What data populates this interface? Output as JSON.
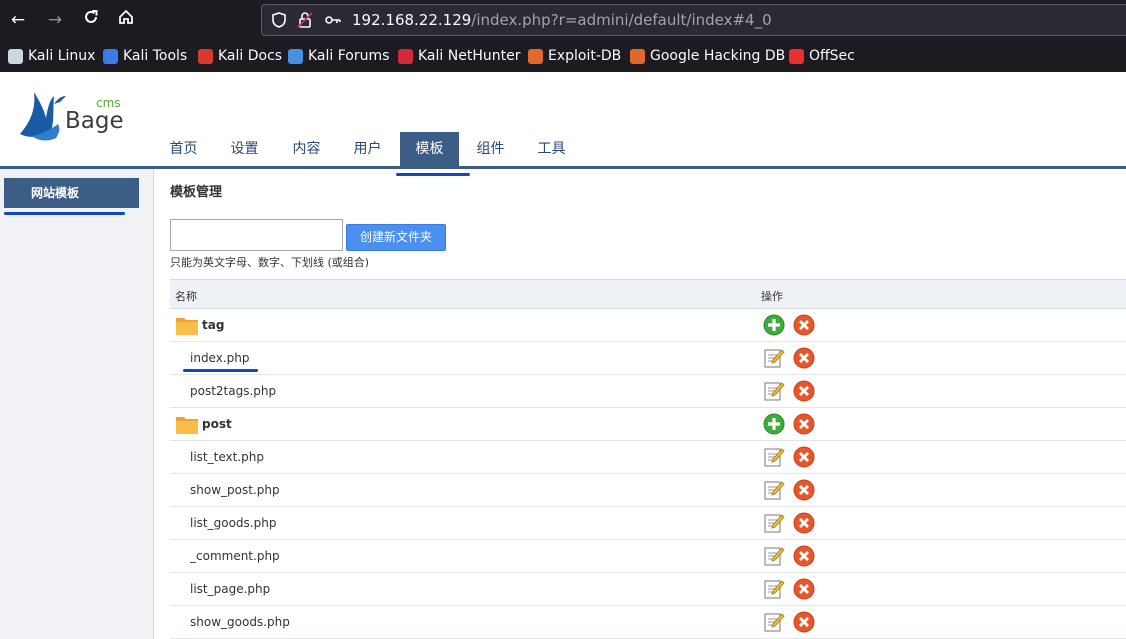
{
  "browser": {
    "url_host": "192.168.22.129",
    "url_path": "/index.php?r=admini/default/index#4_0"
  },
  "bookmarks": [
    {
      "label": "Kali Linux",
      "icon": "kali-dragon-icon"
    },
    {
      "label": "Kali Tools",
      "icon": "kali-tools-icon"
    },
    {
      "label": "Kali Docs",
      "icon": "kali-docs-icon"
    },
    {
      "label": "Kali Forums",
      "icon": "kali-forums-icon"
    },
    {
      "label": "Kali NetHunter",
      "icon": "kali-nethunter-icon"
    },
    {
      "label": "Exploit-DB",
      "icon": "exploit-db-icon"
    },
    {
      "label": "Google Hacking DB",
      "icon": "ghdb-icon"
    },
    {
      "label": "OffSec",
      "icon": "offsec-icon"
    }
  ],
  "logo": {
    "cms": "cms",
    "name": "Bage"
  },
  "nav": {
    "tabs": [
      "首页",
      "设置",
      "内容",
      "用户",
      "模板",
      "组件",
      "工具"
    ],
    "active_index": 4
  },
  "sidebar": {
    "items": [
      {
        "label": "网站模板"
      }
    ]
  },
  "main": {
    "title": "模板管理",
    "folder_input_value": "",
    "create_button": "创建新文件夹",
    "hint": "只能为英文字母、数字、下划线 (或组合)",
    "table": {
      "headers": [
        "名称",
        "操作"
      ],
      "rows": [
        {
          "type": "folder",
          "name": "tag"
        },
        {
          "type": "file",
          "name": "index.php"
        },
        {
          "type": "file",
          "name": "post2tags.php"
        },
        {
          "type": "folder",
          "name": "post"
        },
        {
          "type": "file",
          "name": "list_text.php"
        },
        {
          "type": "file",
          "name": "show_post.php"
        },
        {
          "type": "file",
          "name": "list_goods.php"
        },
        {
          "type": "file",
          "name": "_comment.php"
        },
        {
          "type": "file",
          "name": "list_page.php"
        },
        {
          "type": "file",
          "name": "show_goods.php"
        }
      ]
    }
  },
  "colors": {
    "nav_blue": "#3b5d86",
    "highlight": "#1346c4",
    "button": "#4b8ff1"
  }
}
